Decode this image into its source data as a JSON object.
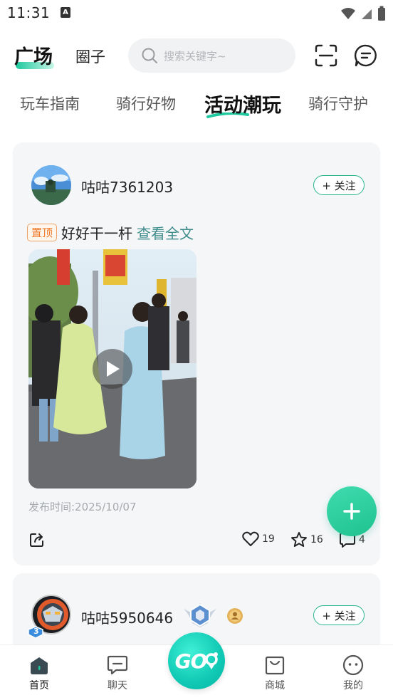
{
  "status_bar": {
    "time": "11:31",
    "notification_icon": "a-icon"
  },
  "header": {
    "tabs": [
      {
        "label": "广场",
        "active": true
      },
      {
        "label": "圈子",
        "active": false
      }
    ],
    "search": {
      "placeholder": "搜索关键字~"
    },
    "icons": [
      "scan-icon",
      "message-icon"
    ]
  },
  "category_tabs": [
    {
      "label": "玩车指南",
      "active": false
    },
    {
      "label": "骑行好物",
      "active": false
    },
    {
      "label": "活动潮玩",
      "active": true
    },
    {
      "label": "骑行守护",
      "active": false
    }
  ],
  "posts": [
    {
      "username": "咕咕7361203",
      "follow_label": "+ 关注",
      "pin_label": "置顶",
      "text": "好好干一杆",
      "read_more": "查看全文",
      "publish_time": "发布时间:2025/10/07",
      "likes": "19",
      "stars": "16",
      "comments": "4"
    },
    {
      "username": "咕咕5950646",
      "follow_label": "+ 关注",
      "badge_level": "3"
    }
  ],
  "bottom_nav": [
    {
      "label": "首页",
      "icon": "home-icon",
      "active": true
    },
    {
      "label": "聊天",
      "icon": "chat-icon",
      "active": false
    },
    {
      "label": "GO",
      "icon": "go-icon",
      "active": false
    },
    {
      "label": "商城",
      "icon": "shop-bag-icon",
      "active": false
    },
    {
      "label": "我的",
      "icon": "profile-icon",
      "active": false
    }
  ],
  "colors": {
    "accent": "#1ec9a0",
    "follow_border": "#2bb58e",
    "pin": "#f07a2c",
    "read_more": "#3e8c8c",
    "card_bg": "#f5f6f8"
  }
}
